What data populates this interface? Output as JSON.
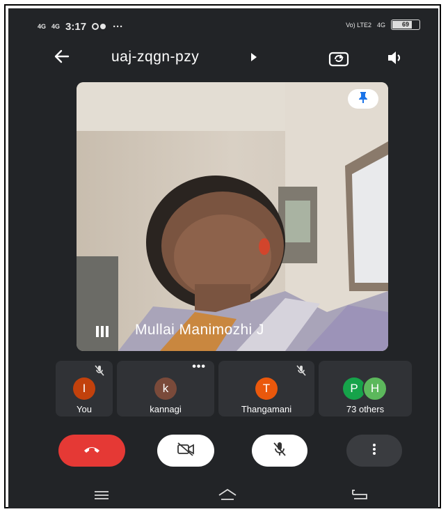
{
  "status_bar": {
    "sig1": "4G",
    "sig2": "4G",
    "time": "3:17",
    "more": "···",
    "volte": "Vo) LTE2",
    "sig3": "4G",
    "battery": "69"
  },
  "header": {
    "meeting_code": "uaj-zqgn-pzy"
  },
  "main_video": {
    "speaker_name": "Mullai Manimozhi J"
  },
  "participants": [
    {
      "initial": "I",
      "label": "You",
      "color": "#c2410c"
    },
    {
      "initial": "k",
      "label": "kannagi",
      "color": "#7a4a3a"
    },
    {
      "initial": "T",
      "label": "Thangamani",
      "color": "#ea580c"
    },
    {
      "initial": "P",
      "label": "73 others",
      "color": "#16a34a"
    },
    {
      "initial": "H",
      "label": "",
      "color": "#5cb85c"
    }
  ],
  "colors": {
    "end_call": "#e53935",
    "background": "#222427",
    "tile": "#303236"
  }
}
